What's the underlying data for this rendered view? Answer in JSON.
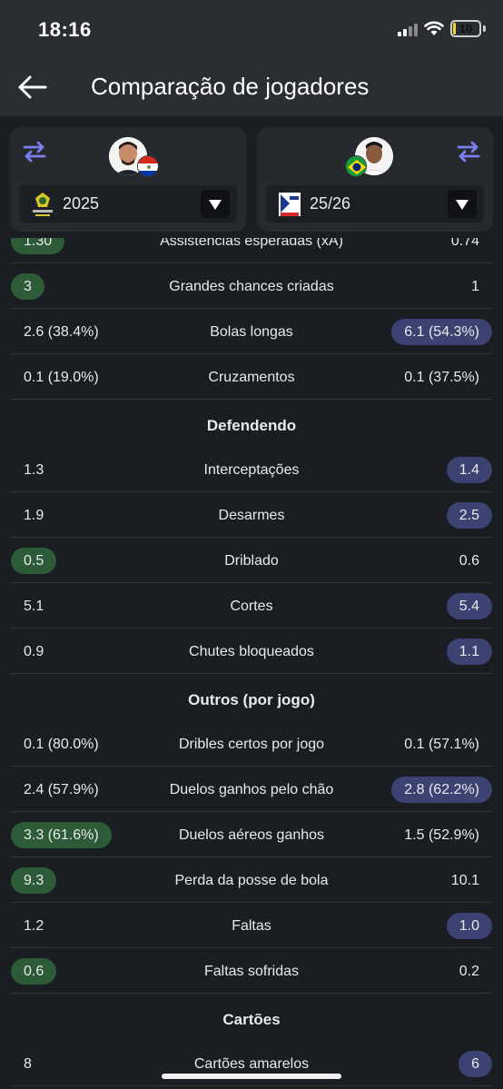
{
  "status": {
    "time": "18:16",
    "battery": "10",
    "battery_level": 0.1
  },
  "header": {
    "title": "Comparação de jogadores",
    "back_icon": "arrow-left-icon"
  },
  "players": {
    "left": {
      "season": "2025",
      "league_icon": "brasileirao-logo",
      "country_flag": "paraguay-flag-icon"
    },
    "right": {
      "season": "25/26",
      "league_icon": "liga-portugal-logo",
      "country_flag": "brazil-flag-icon"
    }
  },
  "colors": {
    "left_highlight": "#2d5a37",
    "right_highlight": "#3c4272",
    "swap_icon": "#7b7ff2"
  },
  "stats": {
    "passing": [
      {
        "label": "Assistências esperadas (xA)",
        "left": "1.30",
        "right": "0.74",
        "winner": "left"
      },
      {
        "label": "Grandes chances criadas",
        "left": "3",
        "right": "1",
        "winner": "left"
      },
      {
        "label": "Bolas longas",
        "left": "2.6 (38.4%)",
        "right": "6.1 (54.3%)",
        "winner": "right"
      },
      {
        "label": "Cruzamentos",
        "left": "0.1 (19.0%)",
        "right": "0.1 (37.5%)",
        "winner": "none"
      }
    ],
    "defending_title": "Defendendo",
    "defending": [
      {
        "label": "Interceptações",
        "left": "1.3",
        "right": "1.4",
        "winner": "right"
      },
      {
        "label": "Desarmes",
        "left": "1.9",
        "right": "2.5",
        "winner": "right"
      },
      {
        "label": "Driblado",
        "left": "0.5",
        "right": "0.6",
        "winner": "left"
      },
      {
        "label": "Cortes",
        "left": "5.1",
        "right": "5.4",
        "winner": "right"
      },
      {
        "label": "Chutes bloqueados",
        "left": "0.9",
        "right": "1.1",
        "winner": "right"
      }
    ],
    "others_title": "Outros (por jogo)",
    "others": [
      {
        "label": "Dribles certos por jogo",
        "left": "0.1 (80.0%)",
        "right": "0.1 (57.1%)",
        "winner": "none"
      },
      {
        "label": "Duelos ganhos pelo chão",
        "left": "2.4 (57.9%)",
        "right": "2.8 (62.2%)",
        "winner": "right"
      },
      {
        "label": "Duelos aéreos ganhos",
        "left": "3.3 (61.6%)",
        "right": "1.5 (52.9%)",
        "winner": "left"
      },
      {
        "label": "Perda da posse de bola",
        "left": "9.3",
        "right": "10.1",
        "winner": "left"
      },
      {
        "label": "Faltas",
        "left": "1.2",
        "right": "1.0",
        "winner": "right"
      },
      {
        "label": "Faltas sofridas",
        "left": "0.6",
        "right": "0.2",
        "winner": "left"
      }
    ],
    "cards_title": "Cartões",
    "cards": [
      {
        "label": "Cartões amarelos",
        "left": "8",
        "right": "6",
        "winner": "right"
      }
    ]
  }
}
